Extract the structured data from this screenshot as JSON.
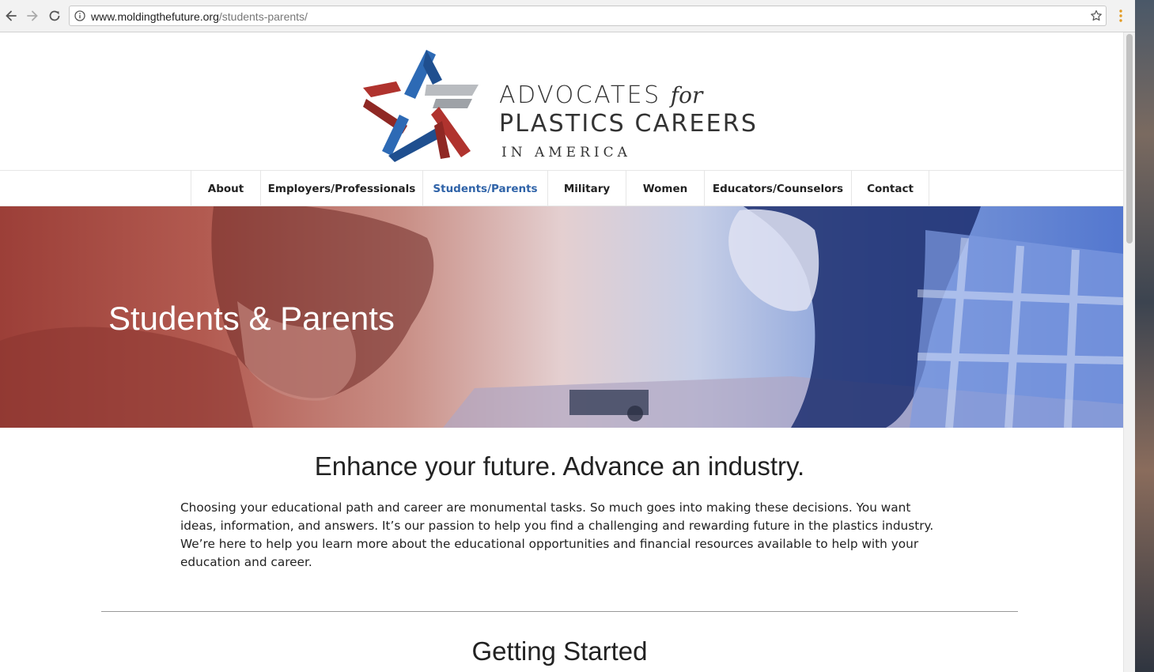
{
  "browser": {
    "url_domain": "www.moldingthefuture.org",
    "url_path": "/students-parents/"
  },
  "logo": {
    "line1": "ADVOCATES",
    "line1_italic": "for",
    "line2": "PLASTICS CAREERS",
    "line3": "IN AMERICA",
    "colors": {
      "red": "#b0332e",
      "blue": "#2d6ab5",
      "gray": "#b9bcc0"
    }
  },
  "nav": {
    "items": [
      {
        "label": "About",
        "active": false
      },
      {
        "label": "Employers/Professionals",
        "active": false
      },
      {
        "label": "Students/Parents",
        "active": true
      },
      {
        "label": "Military",
        "active": false
      },
      {
        "label": "Women",
        "active": false
      },
      {
        "label": "Educators/Counselors",
        "active": false
      },
      {
        "label": "Contact",
        "active": false
      }
    ],
    "active_color": "#2f63a8"
  },
  "hero": {
    "title": "Students & Parents"
  },
  "main": {
    "headline": "Enhance your future. Advance an industry.",
    "intro": "Choosing your educational path and career are monumental tasks. So much goes into making these decisions. You want ideas, information, and answers. It’s our passion to help you find a challenging and rewarding future in the plastics industry. We’re here to help you learn more about the educational opportunities and financial resources available to help with your education and career.",
    "section_title": "Getting Started"
  },
  "icons": [
    "back-arrow-icon",
    "forward-arrow-icon",
    "reload-icon",
    "info-icon",
    "bookmark-star-icon",
    "menu-dots-icon"
  ]
}
